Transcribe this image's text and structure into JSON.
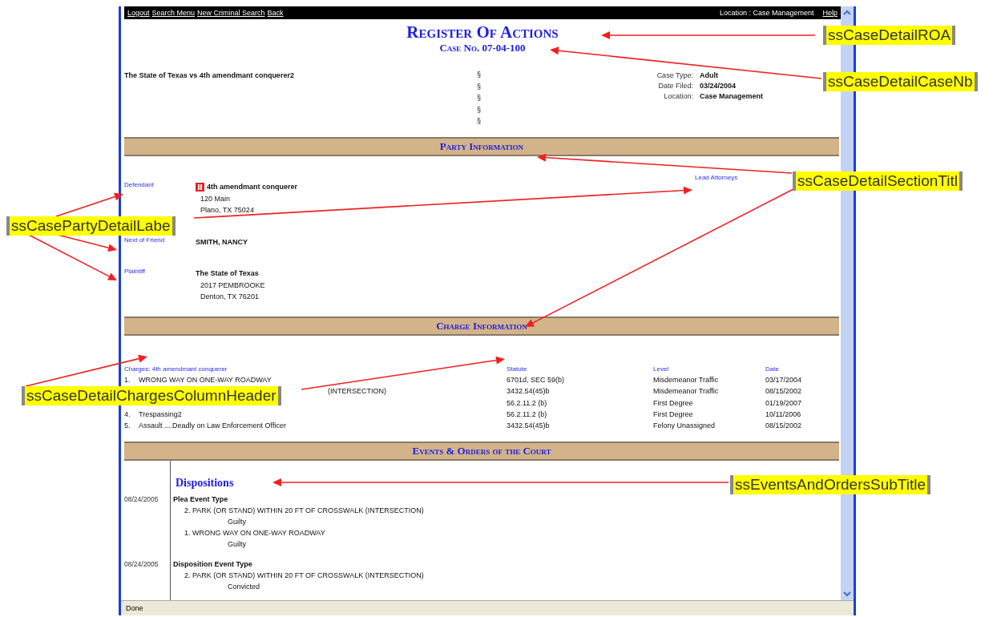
{
  "nav_links": [
    "Logout",
    "Search Menu",
    "New Criminal Search",
    "Back"
  ],
  "location": "Location : Case Management",
  "help": "Help",
  "title": "Register Of Actions",
  "case_no": "Case No. 07-04-100",
  "case_style": "The State of Texas vs 4th amendmant conquerer2",
  "section_marks": [
    "§",
    "§",
    "§",
    "§",
    "§"
  ],
  "case_info": [
    {
      "label": "Case Type:",
      "value": "Adult"
    },
    {
      "label": "Date Filed:",
      "value": "03/24/2004"
    },
    {
      "label": "Location:",
      "value": "Case Management"
    }
  ],
  "party_section": {
    "title": "Party Information",
    "lead_attorneys": "Lead Attorneys",
    "parties": [
      {
        "role": "Defendant",
        "flagged": true,
        "name": "4th amendmant conquerer",
        "address": [
          "120 Main",
          "Plano, TX 75024"
        ]
      },
      {
        "role": "Next of Friend",
        "flagged": false,
        "name": "SMITH, NANCY"
      },
      {
        "role": "Plaintiff",
        "flagged": false,
        "name": "The State of Texas",
        "address": [
          "2017 PEMBROOKE",
          "Denton, TX 76201"
        ]
      }
    ]
  },
  "charge_section": {
    "title": "Charge Information",
    "columns": [
      "Charges: 4th amendmant conquerer",
      "Statute",
      "Level",
      "Date"
    ],
    "rows": [
      {
        "num": "1.",
        "description": "WRONG WAY ON ONE-WAY ROADWAY",
        "statute": "6701d, SEC 59(b)",
        "level": "Misdemeanor Traffic",
        "date": "03/17/2004"
      },
      {
        "description": "(INTERSECTION)",
        "statute": "3432.54(45)b",
        "level": "Misdemeanor Traffic",
        "date": "08/15/2002"
      },
      {
        "statute": "56.2.11.2 (b)",
        "level": "First Degree",
        "date": "01/19/2007"
      },
      {
        "num": "4.",
        "description": "Trespassing2",
        "statute": "56.2.11.2 (b)",
        "level": "First Degree",
        "date": "10/11/2006"
      },
      {
        "num": "5.",
        "description": "Assault ....Deadly on Law Enforcement Officer",
        "statute": "3432.54(45)b",
        "level": "Felony Unassigned",
        "date": "08/15/2002"
      }
    ]
  },
  "events_section": {
    "title": "Events & Orders of the Court",
    "subtitle": "Dispositions",
    "events": [
      {
        "date": "08/24/2005",
        "type": "Plea Event Type",
        "lines": [
          {
            "charge": "2. PARK (OR STAND) WITHIN 20 FT OF CROSSWALK (INTERSECTION)",
            "result": "Guilty"
          },
          {
            "charge": "1. WRONG WAY ON ONE-WAY ROADWAY",
            "result": "Guilty"
          }
        ]
      },
      {
        "date": "08/24/2005",
        "type": "Disposition Event Type",
        "lines": [
          {
            "charge": "2. PARK (OR STAND) WITHIN 20 FT OF CROSSWALK (INTERSECTION)",
            "result": "Convicted"
          }
        ]
      }
    ]
  },
  "status_bar": "Done",
  "callouts": [
    "ssCaseDetailROA",
    "ssCaseDetailCaseNb",
    "ssCasePartyDetailLabe",
    "ssCaseDetailSectionTitl",
    "ssCaseDetailChargesColumnHeader",
    "ssEventsAndOrdersSubTitle"
  ]
}
